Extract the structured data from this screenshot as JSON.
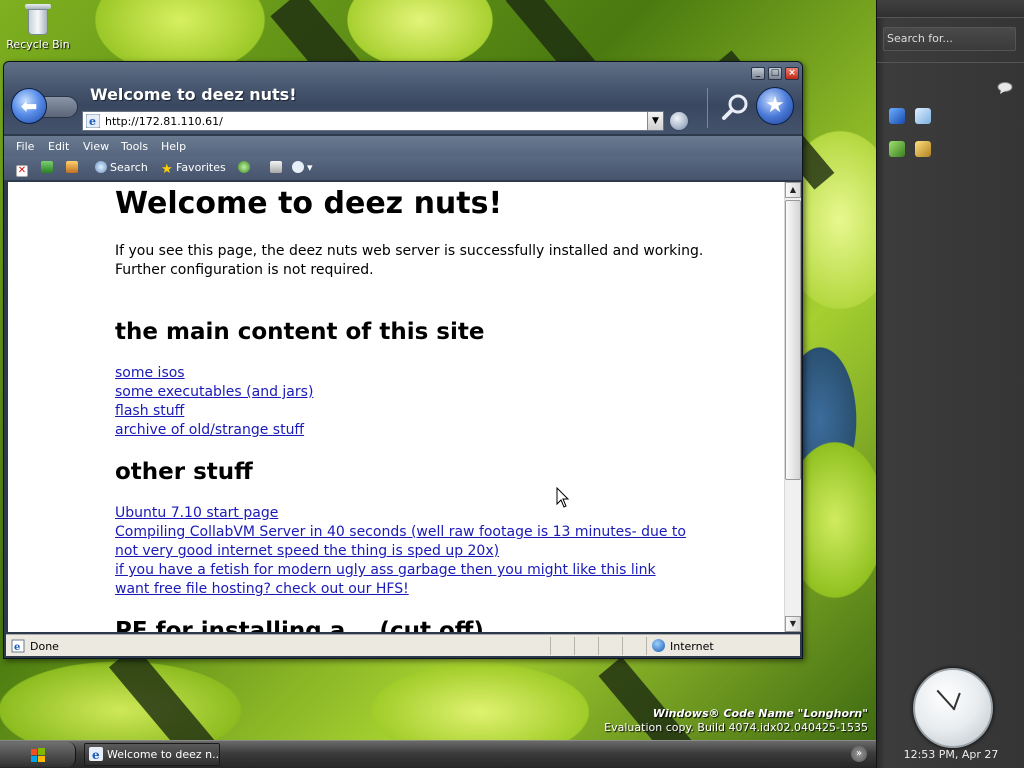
{
  "desktop": {
    "icons": [
      {
        "label": "Recycle Bin"
      }
    ],
    "watermark": {
      "line1": "Windows® Code Name \"Longhorn\"",
      "line2": "Evaluation copy. Build 4074.idx02.040425-1535"
    }
  },
  "sidebar": {
    "search_placeholder": "Search for...",
    "clock_text": "12:53 PM, Apr 27"
  },
  "taskbar": {
    "task_label": "Welcome to deez n..."
  },
  "window": {
    "title": "Welcome to deez nuts!",
    "address": "http://172.81.110.61/",
    "controls": {
      "minimize": "_",
      "maximize": "□",
      "close": "×"
    },
    "menu": [
      "File",
      "Edit",
      "View",
      "Tools",
      "Help"
    ],
    "toolbar": {
      "search_label": "Search",
      "favorites_label": "Favorites"
    },
    "status": {
      "text": "Done",
      "zone": "Internet"
    }
  },
  "page": {
    "heading": "Welcome to deez nuts!",
    "intro": "If you see this page, the deez nuts web server is successfully installed and working. Further configuration is not required.",
    "section1_title": "the main content of this site",
    "section1_links": [
      "some isos",
      "some executables (and jars)",
      "flash stuff",
      "archive of old/strange stuff"
    ],
    "section2_title": "other stuff",
    "section2_links": [
      "Ubuntu 7.10 start page",
      "Compiling CollabVM Server in 40 seconds (well raw footage is 13 minutes- due to not very good internet speed the thing is sped up 20x)",
      "if you have a fetish for modern ugly ass garbage then you might like this link",
      "want free file hosting? check out our HFS!"
    ],
    "section3_title": "PE for installing a... (cut off)"
  },
  "colors": {
    "link": "#1a1ab8",
    "sidebar_bg": "#353535",
    "window_frame": "#2d3a4c"
  }
}
